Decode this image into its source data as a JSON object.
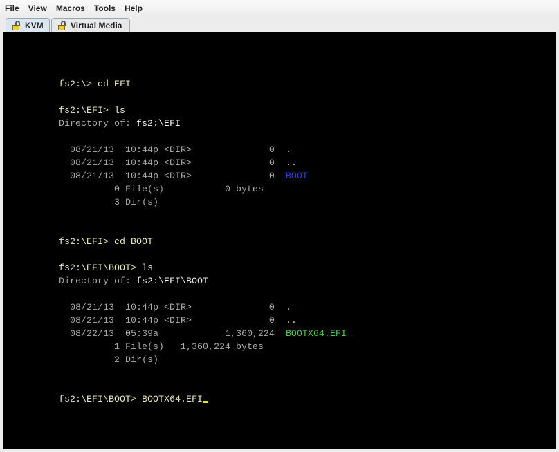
{
  "menu": [
    "File",
    "View",
    "Macros",
    "Tools",
    "Help"
  ],
  "tabs": [
    {
      "label": "KVM",
      "active": true
    },
    {
      "label": "Virtual Media",
      "active": false
    }
  ],
  "colors": {
    "prompt": "#e4e4b4",
    "listing": "#a8a8a8",
    "path": "#ececec",
    "dir": "#3040e0",
    "exe": "#48c848",
    "dots": "#c8c870"
  },
  "terminal": {
    "lines": [
      [
        {
          "t": "fs2:\\> cd EFI",
          "c": "prompt"
        }
      ],
      [],
      [
        {
          "t": "fs2:\\EFI> ls",
          "c": "prompt"
        }
      ],
      [
        {
          "t": "Directory of: ",
          "c": "listing"
        },
        {
          "t": "fs2:\\EFI",
          "c": "path"
        }
      ],
      [],
      [
        {
          "t": "  08/21/13  10:44p <DIR>              0  ",
          "c": "listing"
        },
        {
          "t": ".",
          "c": "dots"
        }
      ],
      [
        {
          "t": "  08/21/13  10:44p <DIR>              0  ",
          "c": "listing"
        },
        {
          "t": "..",
          "c": "dots"
        }
      ],
      [
        {
          "t": "  08/21/13  10:44p <DIR>              0  ",
          "c": "listing"
        },
        {
          "t": "BOOT",
          "c": "dir"
        }
      ],
      [
        {
          "t": "          0 File(s)           0 bytes",
          "c": "listing"
        }
      ],
      [
        {
          "t": "          3 Dir(s)",
          "c": "listing"
        }
      ],
      [],
      [],
      [
        {
          "t": "fs2:\\EFI> cd BOOT",
          "c": "prompt"
        }
      ],
      [],
      [
        {
          "t": "fs2:\\EFI\\BOOT> ls",
          "c": "prompt"
        }
      ],
      [
        {
          "t": "Directory of: ",
          "c": "listing"
        },
        {
          "t": "fs2:\\EFI\\BOOT",
          "c": "path"
        }
      ],
      [],
      [
        {
          "t": "  08/21/13  10:44p <DIR>              0  ",
          "c": "listing"
        },
        {
          "t": ".",
          "c": "dots"
        }
      ],
      [
        {
          "t": "  08/21/13  10:44p <DIR>              0  ",
          "c": "listing"
        },
        {
          "t": "..",
          "c": "dots"
        }
      ],
      [
        {
          "t": "  08/22/13  05:39a            1,360,224  ",
          "c": "listing"
        },
        {
          "t": "BOOTX64.EFI",
          "c": "exe"
        }
      ],
      [
        {
          "t": "          1 File(s)   1,360,224 bytes",
          "c": "listing"
        }
      ],
      [
        {
          "t": "          2 Dir(s)",
          "c": "listing"
        }
      ],
      [],
      [],
      [
        {
          "t": "fs2:\\EFI\\BOOT> BOOTX64.EFI",
          "c": "prompt"
        }
      ]
    ]
  }
}
